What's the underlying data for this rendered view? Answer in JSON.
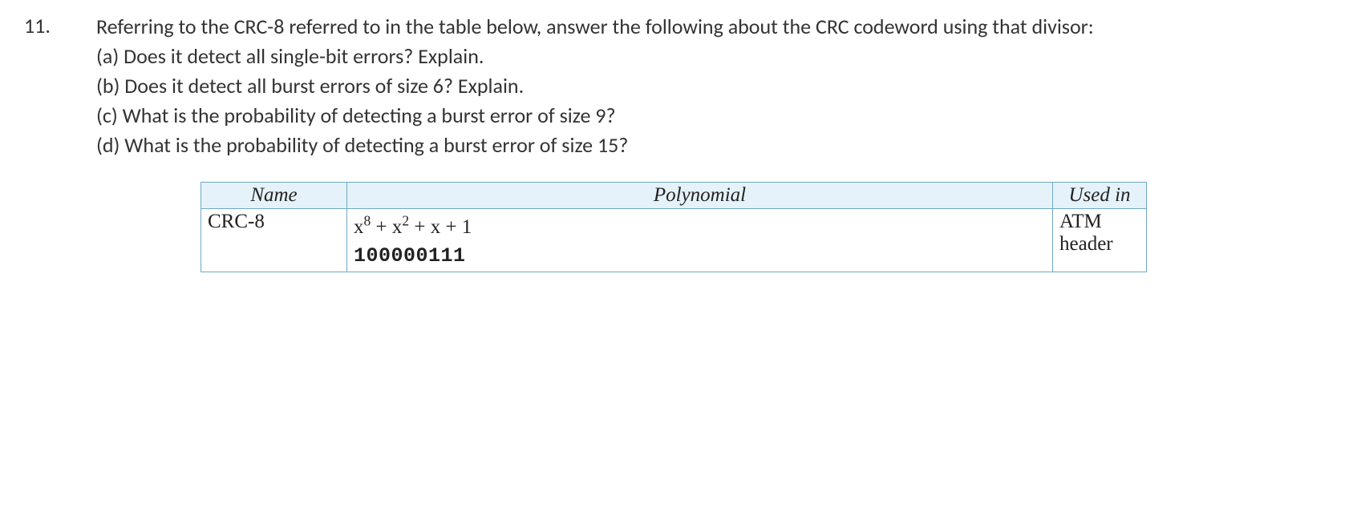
{
  "question": {
    "number": "11.",
    "intro": "Referring to the CRC-8 referred to in the table below, answer the following about the CRC codeword using that divisor:",
    "parts": {
      "a": "(a)  Does it detect all single-bit errors?  Explain.",
      "b": "(b)  Does it detect all burst errors of size 6?  Explain.",
      "c": "(c)  What is the probability of detecting a burst error of size 9?",
      "d": "(d)  What is the probability of detecting a burst error of size 15?"
    }
  },
  "table": {
    "headers": {
      "name": "Name",
      "polynomial": "Polynomial",
      "used_in": "Used in"
    },
    "row": {
      "name": "CRC-8",
      "poly_x8": "x",
      "poly_sup8": "8",
      "poly_plus1": " + x",
      "poly_sup2": "2",
      "poly_rest": " + x + 1",
      "binary": "100000111",
      "used_line1": "ATM",
      "used_line2": "header"
    }
  }
}
